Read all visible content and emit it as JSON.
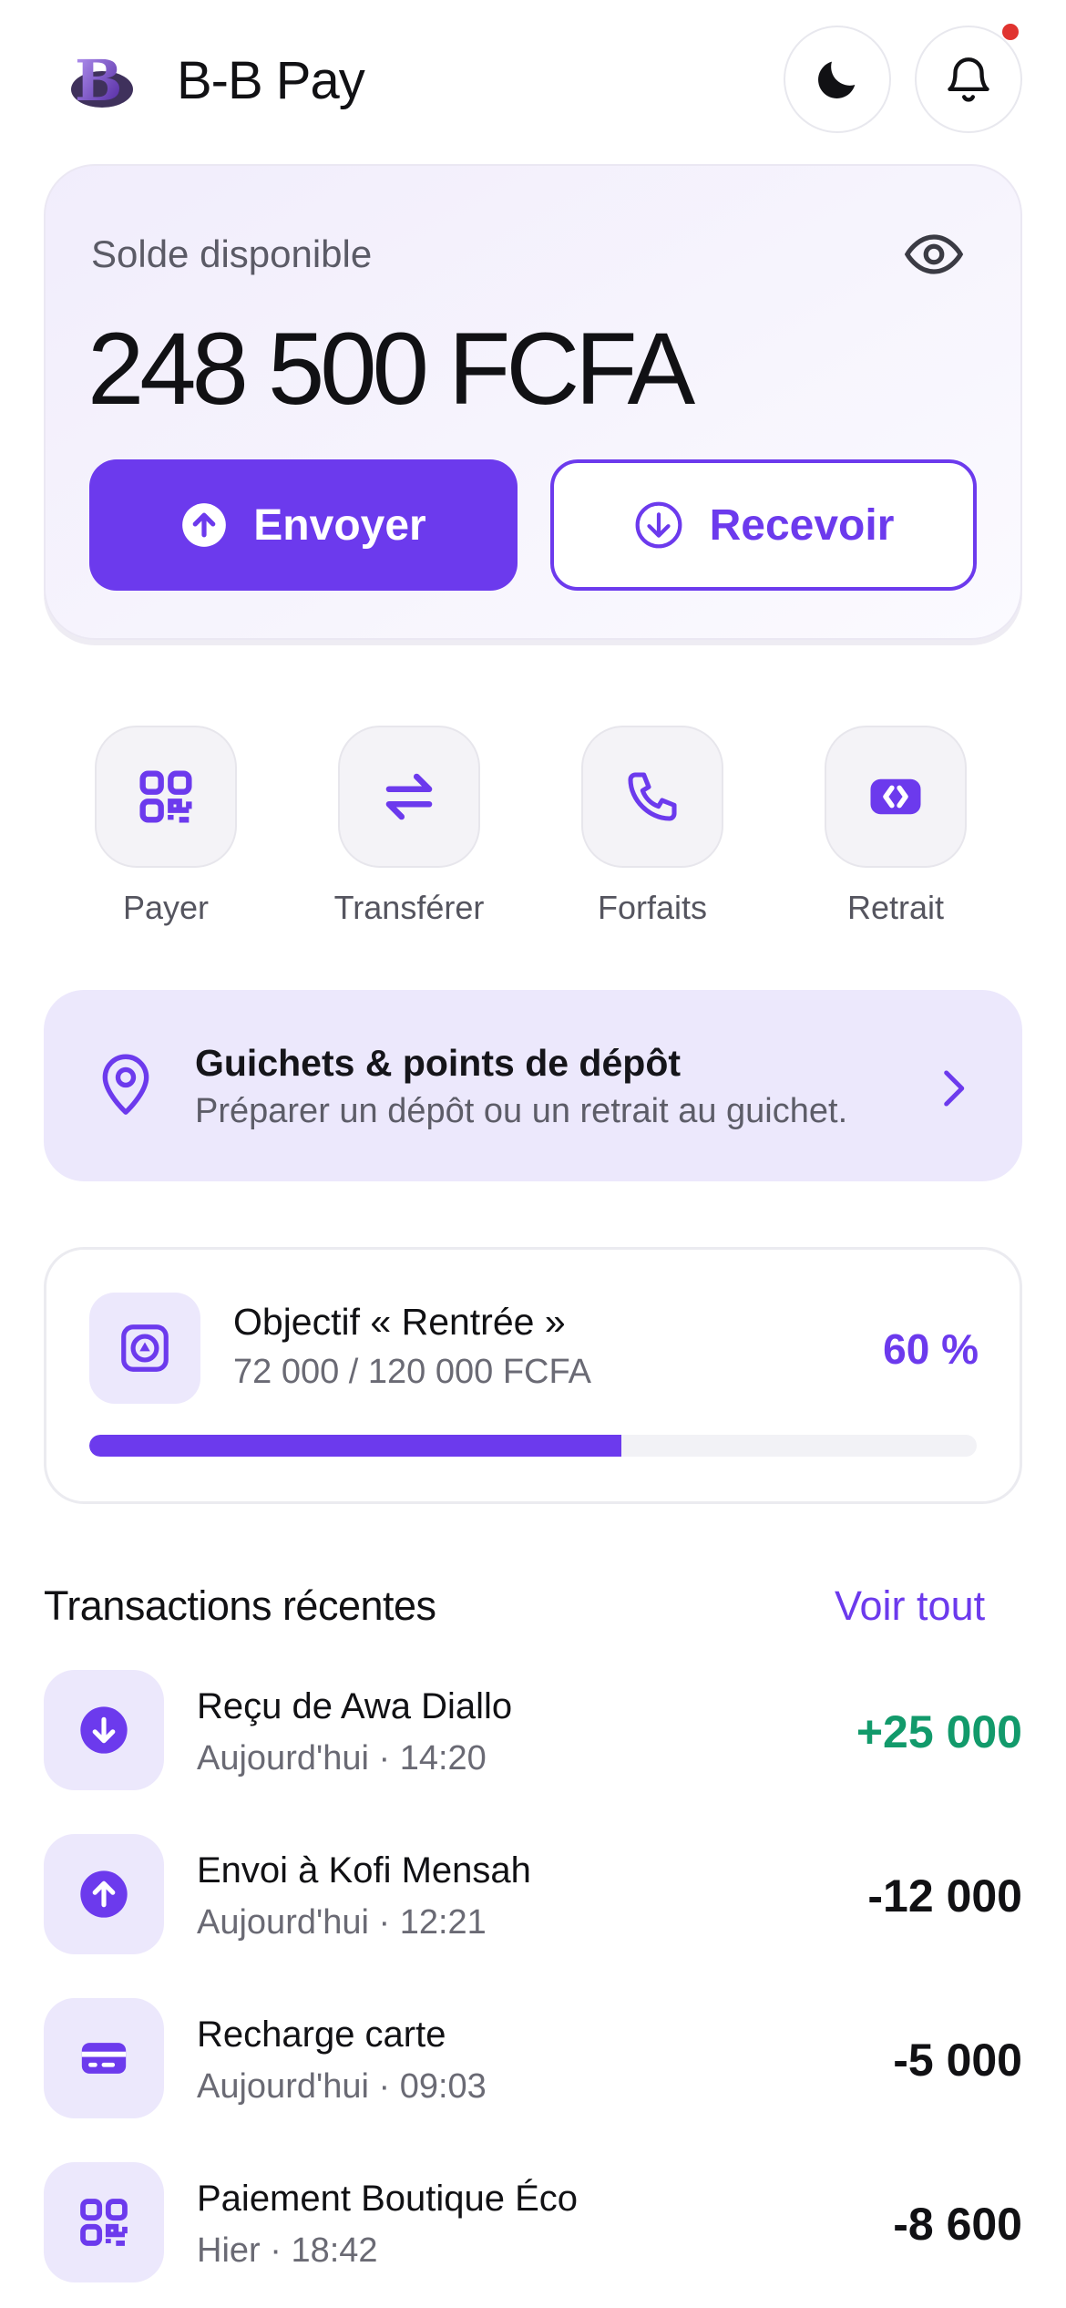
{
  "header": {
    "app_title": "B-B Pay",
    "logo_letter": "B",
    "theme_icon": "moon-icon",
    "notifications_icon": "bell-icon",
    "has_unread_notifications": true
  },
  "balance": {
    "label": "Solde disponible",
    "amount": "248 500 FCFA",
    "visibility_icon": "eye-icon",
    "send_label": "Envoyer",
    "receive_label": "Recevoir"
  },
  "quick_actions": [
    {
      "label": "Payer",
      "icon": "qr-code-icon"
    },
    {
      "label": "Transférer",
      "icon": "transfer-arrows-icon"
    },
    {
      "label": "Forfaits",
      "icon": "phone-icon"
    },
    {
      "label": "Retrait",
      "icon": "withdraw-icon"
    }
  ],
  "agents_banner": {
    "title": "Guichets & points de dépôt",
    "subtitle": "Préparer un dépôt ou un retrait au guichet.",
    "icon": "map-pin-icon"
  },
  "goal": {
    "title": "Objectif « Rentrée »",
    "progress_text": "72 000 / 120 000 FCFA",
    "percent_label": "60 %",
    "progress_fraction": 0.6
  },
  "transactions": {
    "heading": "Transactions récentes",
    "see_all": "Voir tout",
    "items": [
      {
        "title": "Reçu de Awa Diallo",
        "meta": "Aujourd'hui · 14:20",
        "amount": "+25 000",
        "type": "in",
        "icon": "arrow-down-icon"
      },
      {
        "title": "Envoi à Kofi Mensah",
        "meta": "Aujourd'hui · 12:21",
        "amount": "-12 000",
        "type": "out",
        "icon": "arrow-up-icon"
      },
      {
        "title": "Recharge carte",
        "meta": "Aujourd'hui · 09:03",
        "amount": "-5 000",
        "type": "out",
        "icon": "card-icon"
      },
      {
        "title": "Paiement Boutique Éco",
        "meta": "Hier · 18:42",
        "amount": "-8 600",
        "type": "out",
        "icon": "qr-code-icon"
      }
    ]
  },
  "colors": {
    "accent": "#6c3aed",
    "accent_soft": "#ece8fc",
    "positive": "#129a6b",
    "notification": "#e0332f"
  }
}
